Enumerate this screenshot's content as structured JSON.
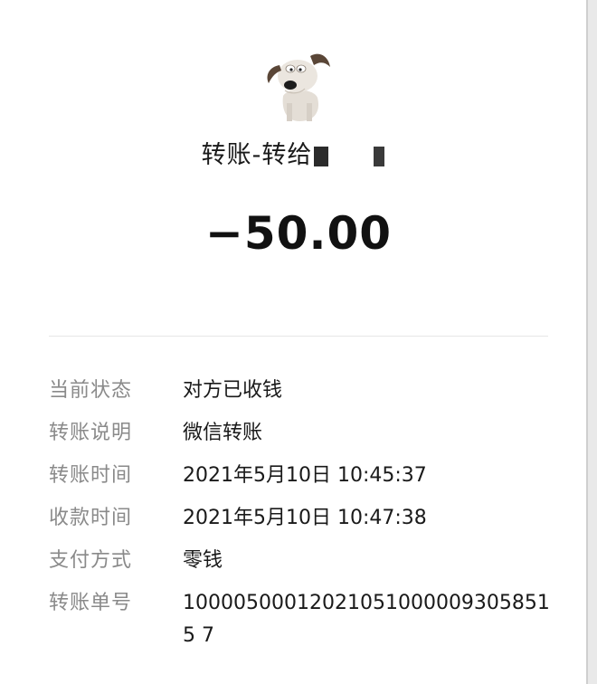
{
  "header": {
    "title": "转账-转给",
    "amount": "−50.00"
  },
  "details": [
    {
      "label": "当前状态",
      "value": "对方已收钱"
    },
    {
      "label": "转账说明",
      "value": "微信转账"
    },
    {
      "label": "转账时间",
      "value": "2021年5月10日 10:45:37"
    },
    {
      "label": "收款时间",
      "value": "2021年5月10日 10:47:38"
    },
    {
      "label": "支付方式",
      "value": "零钱"
    },
    {
      "label": "转账单号",
      "value": "100005000120210510000093058515 7"
    }
  ],
  "colors": {
    "label": "#8a8a8a",
    "value": "#1a1a1a",
    "divider": "#e6e6e6"
  }
}
